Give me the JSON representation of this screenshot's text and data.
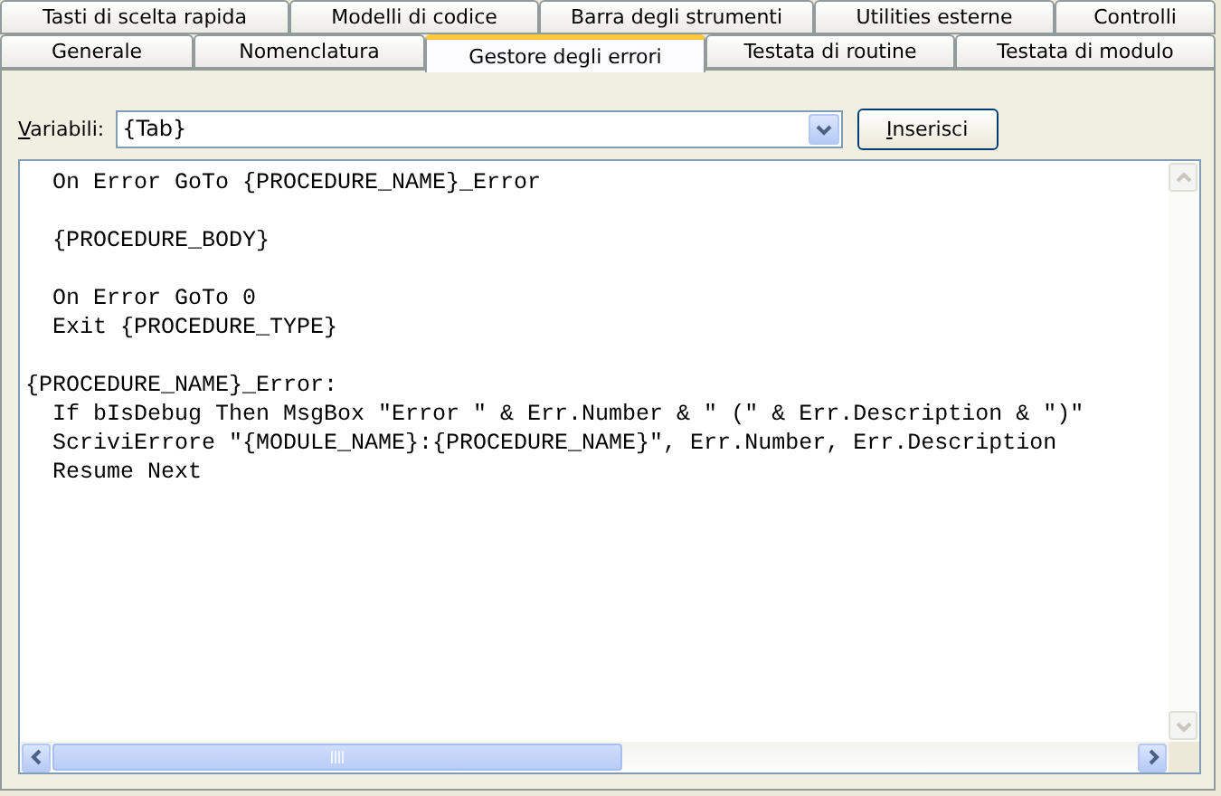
{
  "tabs": {
    "rows": [
      [
        {
          "label": "Tasti di scelta rapida",
          "selected": false
        },
        {
          "label": "Modelli di codice",
          "selected": false
        },
        {
          "label": "Barra degli strumenti",
          "selected": false
        },
        {
          "label": "Utilities esterne",
          "selected": false
        },
        {
          "label": "Controlli",
          "selected": false
        }
      ],
      [
        {
          "label": "Generale",
          "selected": false
        },
        {
          "label": "Nomenclatura",
          "selected": false
        },
        {
          "label": "Gestore degli errori",
          "selected": true
        },
        {
          "label": "Testata di routine",
          "selected": false
        },
        {
          "label": "Testata di modulo",
          "selected": false
        }
      ]
    ]
  },
  "variables": {
    "label": "Variabili:",
    "value": "{Tab}"
  },
  "insert_button": "Inserisci",
  "code_blocks": [
    [
      "  On Error GoTo {PROCEDURE_NAME}_Error"
    ],
    [
      "  {PROCEDURE_BODY}"
    ],
    [
      "  On Error GoTo 0",
      "  Exit {PROCEDURE_TYPE}"
    ],
    [
      "{PROCEDURE_NAME}_Error:",
      "  If bIsDebug Then MsgBox \"Error \" & Err.Number & \" (\" & Err.Description & \")\"",
      "  ScriviErrore \"{MODULE_NAME}:{PROCEDURE_NAME}\", Err.Number, Err.Description",
      "  Resume Next"
    ]
  ]
}
